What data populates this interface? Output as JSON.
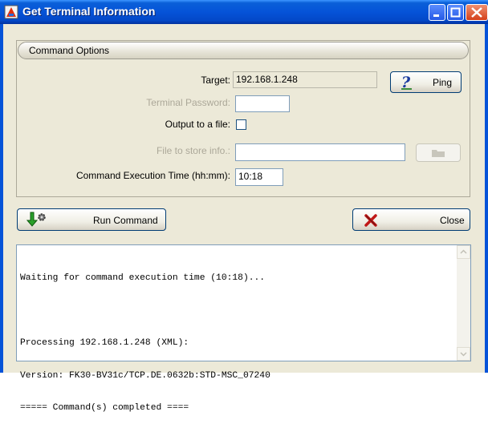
{
  "window": {
    "title": "Get Terminal Information"
  },
  "options": {
    "group_title": "Command Options",
    "target_label": "Target:",
    "target_value": "192.168.1.248",
    "ping_label": "Ping",
    "password_label": "Terminal Password:",
    "password_value": "",
    "output_file_label": "Output to a file:",
    "output_file_checked": false,
    "file_store_label": "File to store info.:",
    "file_store_value": "",
    "exec_time_label": "Command Execution Time (hh:mm):",
    "exec_time_value": "10:18"
  },
  "actions": {
    "run_label": "Run Command",
    "close_label": "Close"
  },
  "output": {
    "lines": [
      "Waiting for command execution time (10:18)...",
      "",
      "Processing 192.168.1.248 (XML):",
      "Version: FK30-BV31c/TCP.DE.0632b:STD-MSC_07240",
      "===== Command(s) completed ===="
    ]
  },
  "icons": {
    "app": "app-icon",
    "ping": "help-question-icon",
    "browse": "folder-icon",
    "run": "run-arrow-gear-icon",
    "close": "red-x-icon"
  }
}
